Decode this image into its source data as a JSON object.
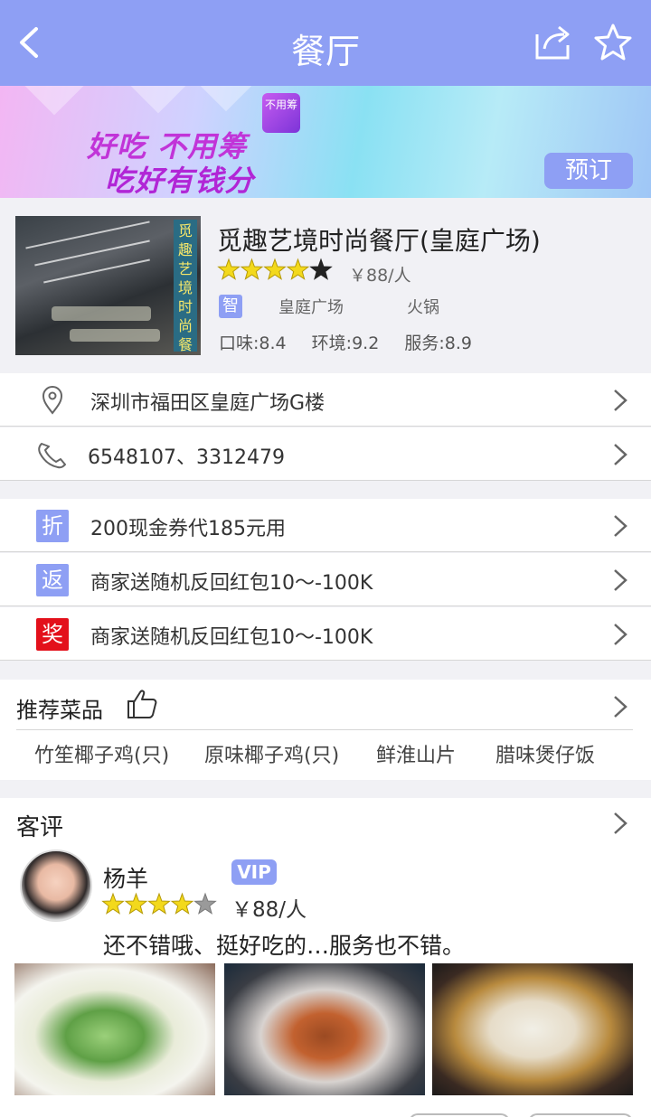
{
  "header": {
    "title": "餐厅"
  },
  "banner": {
    "logo_text": "不用筹",
    "line1": "好吃 不用筹",
    "line2": "吃好有钱分",
    "book_label": "预订"
  },
  "restaurant": {
    "name": "觅趣艺境时尚餐厅(皇庭广场)",
    "rating": 4,
    "price": "￥88/人",
    "tag": "智",
    "area": "皇庭广场",
    "cuisine": "火锅",
    "scores": {
      "taste": "口味:8.4",
      "env": "环境:9.2",
      "service": "服务:8.9"
    },
    "photo_sign": "觅趣艺境时尚餐厅"
  },
  "contact": {
    "address": "深圳市福田区皇庭广场G楼",
    "phone": "6548107、3312479"
  },
  "offers": [
    {
      "badge": "折",
      "color": "#8e9ff4",
      "text": "200现金券代185元用"
    },
    {
      "badge": "返",
      "color": "#8e9ff4",
      "text": "商家送随机反回红包10～-100K"
    },
    {
      "badge": "奖",
      "color": "#e3101b",
      "text": "商家送随机反回红包10～-100K"
    }
  ],
  "dishes": {
    "title": "推荐菜品",
    "items": [
      "竹笙椰子鸡(只)",
      "原味椰子鸡(只)",
      "鲜淮山片",
      "腊味煲仔饭"
    ]
  },
  "reviews": {
    "title": "客评",
    "user": "杨羊",
    "vip": "VIP",
    "rating": 4,
    "price": "￥88/人",
    "comment": "还不错哦、挺好吃的…服务也不错。"
  }
}
